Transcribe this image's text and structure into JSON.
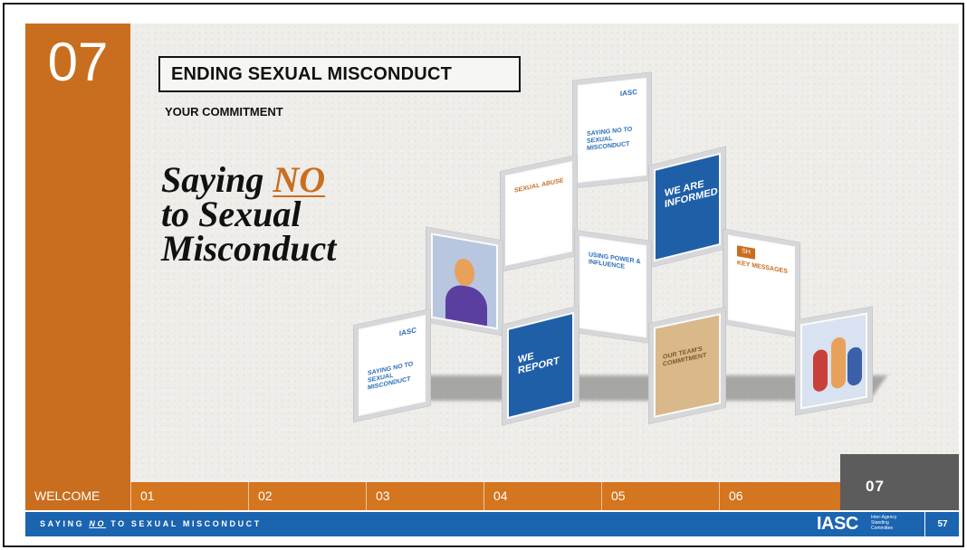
{
  "chapter": {
    "number": "07"
  },
  "header": {
    "title": "ENDING SEXUAL MISCONDUCT",
    "subtitle": "YOUR COMMITMENT"
  },
  "hero": {
    "line1_pre": "Saying ",
    "line1_emph": "NO",
    "line2": "to Sexual",
    "line3": "Misconduct"
  },
  "cards": {
    "top": {
      "logo": "IASC",
      "text": "SAYING NO TO SEXUAL MISCONDUCT"
    },
    "sexual_abuse": {
      "text": "SEXUAL ABUSE"
    },
    "we_are_informed": {
      "text": "WE ARE INFORMED"
    },
    "using_power": {
      "text": "USING POWER & INFLUENCE"
    },
    "key_messages": {
      "tag": "SH",
      "text": "KEY MESSAGES"
    },
    "left": {
      "logo": "IASC",
      "text": "SAYING NO TO SEXUAL MISCONDUCT"
    },
    "we_report": {
      "text": "WE REPORT"
    },
    "team_commitment": {
      "text": "OUR TEAM'S COMMITMENT"
    }
  },
  "nav": {
    "items": [
      {
        "label": "WELCOME"
      },
      {
        "label": "01"
      },
      {
        "label": "02"
      },
      {
        "label": "03"
      },
      {
        "label": "04"
      },
      {
        "label": "05"
      },
      {
        "label": "06"
      }
    ],
    "active": "07"
  },
  "footer": {
    "text_pre": "SAYING ",
    "text_emph": "NO",
    "text_post": " TO SEXUAL MISCONDUCT",
    "logo": "IASC",
    "logo_sub": "Inter-Agency Standing Committee",
    "page": "57"
  },
  "colors": {
    "orange": "#c96e1e",
    "blue": "#1a64b0",
    "gray": "#5c5c5c"
  }
}
